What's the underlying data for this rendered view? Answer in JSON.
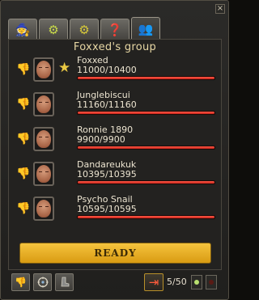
{
  "window": {
    "close_glyph": "×"
  },
  "tabs": [
    {
      "icon": "character-icon",
      "glyph": "🧙",
      "color": "#9ac05a"
    },
    {
      "icon": "gear-icon",
      "glyph": "⚙",
      "color": "#c8d94a"
    },
    {
      "icon": "cogs-icon",
      "glyph": "⚙",
      "color": "#d7c93a"
    },
    {
      "icon": "chat-icon",
      "glyph": "❓",
      "color": "#e0c040"
    },
    {
      "icon": "group-icon",
      "glyph": "👥",
      "color": "#9acb6a"
    }
  ],
  "group": {
    "title": "Foxxed's group",
    "members": [
      {
        "name": "Foxxed",
        "hp_text": "11000/10400",
        "hp_fraction": 1.0,
        "leader": true
      },
      {
        "name": "Junglebiscui",
        "hp_text": "11160/11160",
        "hp_fraction": 1.0,
        "leader": false
      },
      {
        "name": "Ronnie 1890",
        "hp_text": "9900/9900",
        "hp_fraction": 1.0,
        "leader": false
      },
      {
        "name": "Dandareukuk",
        "hp_text": "10395/10395",
        "hp_fraction": 1.0,
        "leader": false
      },
      {
        "name": "Psycho Snail",
        "hp_text": "10595/10595",
        "hp_fraction": 1.0,
        "leader": false
      }
    ]
  },
  "ready_label": "READY",
  "bottom": {
    "count": "5/50"
  },
  "icons": {
    "thumb": "👎",
    "star": "★",
    "exit": "⇥"
  }
}
